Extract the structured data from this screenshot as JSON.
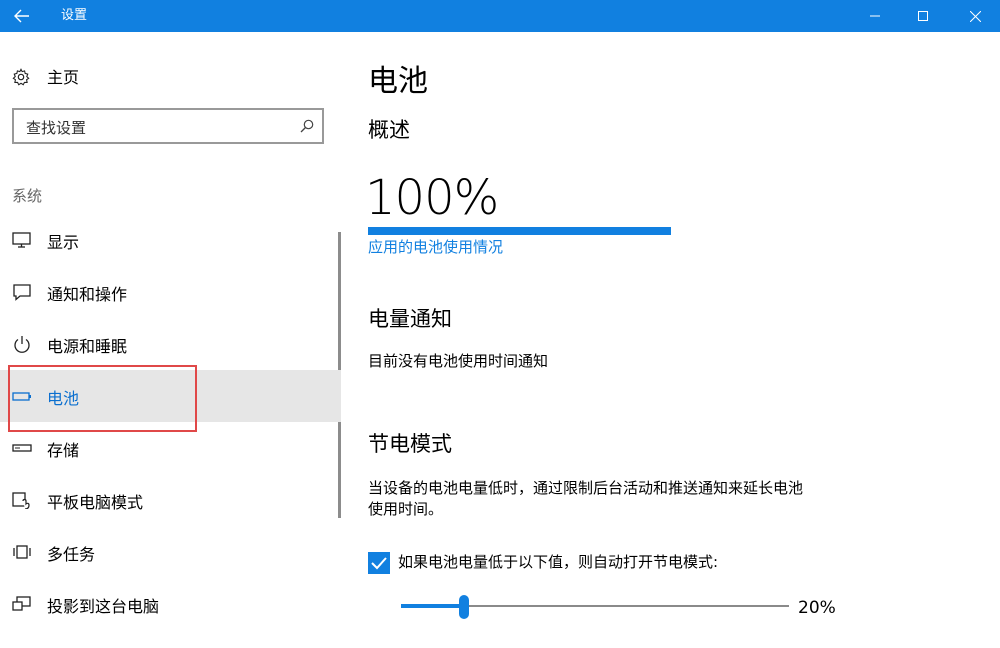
{
  "window": {
    "title": "设置",
    "accent": "#1180e0"
  },
  "sidebar": {
    "home_label": "主页",
    "search_placeholder": "查找设置",
    "group_label": "系统",
    "items": [
      {
        "label": "显示",
        "icon": "monitor-icon"
      },
      {
        "label": "通知和操作",
        "icon": "message-icon"
      },
      {
        "label": "电源和睡眠",
        "icon": "power-icon"
      },
      {
        "label": "电池",
        "icon": "battery-icon",
        "selected": true
      },
      {
        "label": "存储",
        "icon": "storage-icon"
      },
      {
        "label": "平板电脑模式",
        "icon": "tablet-icon"
      },
      {
        "label": "多任务",
        "icon": "multitask-icon"
      },
      {
        "label": "投影到这台电脑",
        "icon": "project-icon"
      }
    ]
  },
  "main": {
    "title": "电池",
    "overview": {
      "heading": "概述",
      "percent": "100%",
      "level": 1.0,
      "link": "应用的电池使用情况"
    },
    "notification": {
      "heading": "电量通知",
      "text": "目前没有电池使用时间通知"
    },
    "saver": {
      "heading": "节电模式",
      "desc_line1": "当设备的电池电量低时，通过限制后台活动和推送通知来延长电池",
      "desc_line2": "使用时间。",
      "checkbox_label": "如果电池电量低于以下值，则自动打开节电模式:",
      "checked": true,
      "slider_value": "20%",
      "slider_level": 0.2
    }
  }
}
